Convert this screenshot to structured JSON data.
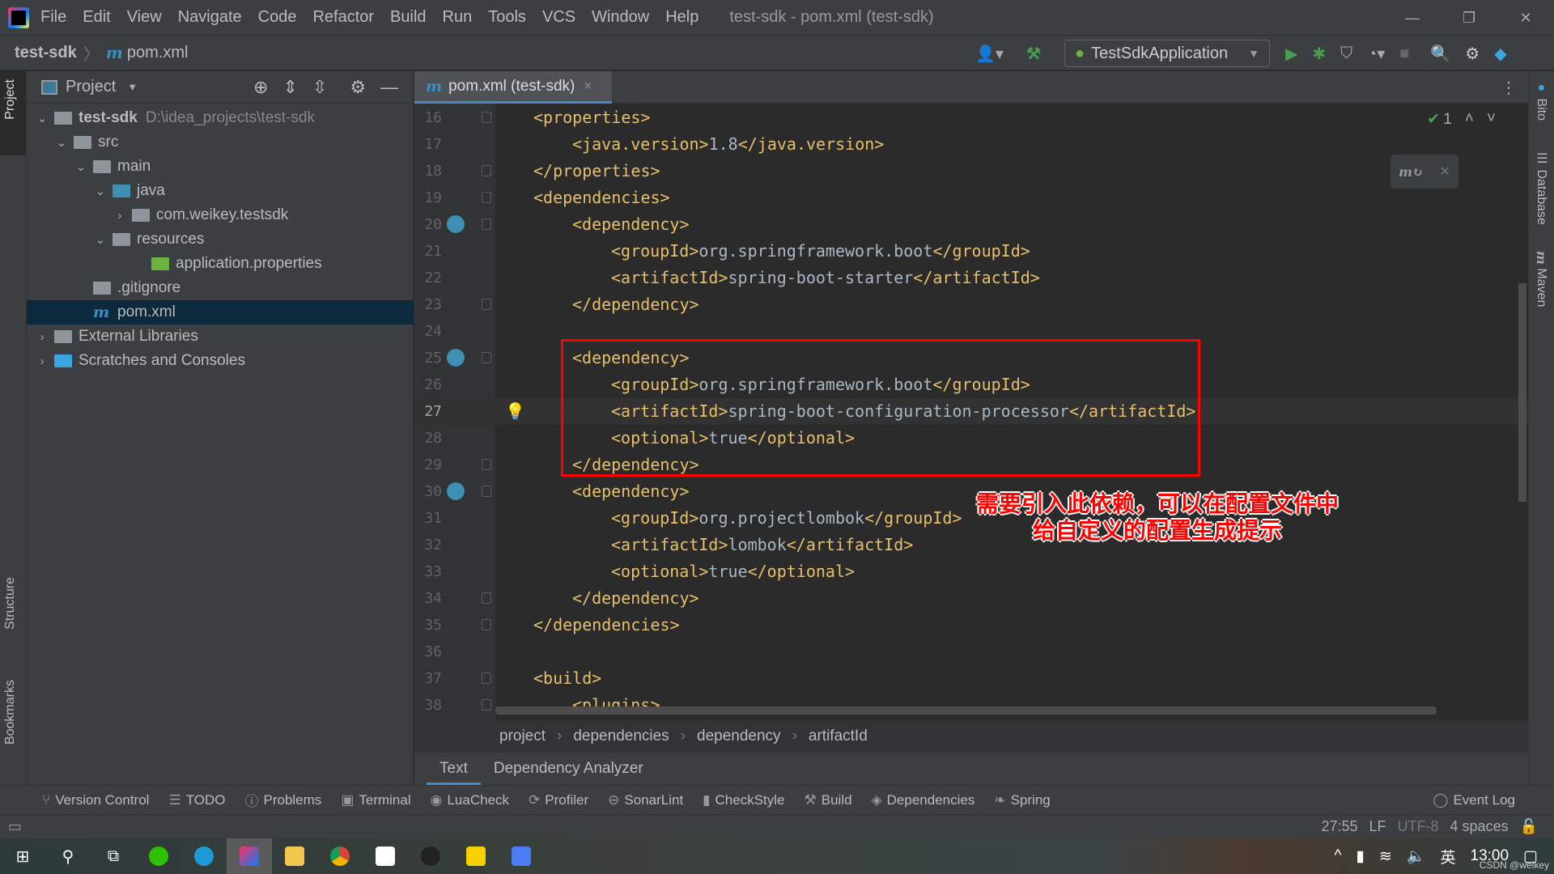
{
  "menu": [
    "File",
    "Edit",
    "View",
    "Navigate",
    "Code",
    "Refactor",
    "Build",
    "Run",
    "Tools",
    "VCS",
    "Window",
    "Help"
  ],
  "window_title": "test-sdk - pom.xml (test-sdk)",
  "nav": {
    "project": "test-sdk",
    "file": "pom.xml",
    "file_icon": "m"
  },
  "run_config": "TestSdkApplication",
  "project_panel": {
    "title": "Project",
    "tree": [
      {
        "label": "test-sdk",
        "path": "D:\\idea_projects\\test-sdk",
        "level": 0,
        "chev": "v",
        "icon": "module-folder",
        "bold": true
      },
      {
        "label": "src",
        "level": 1,
        "chev": "v",
        "icon": "folder"
      },
      {
        "label": "main",
        "level": 2,
        "chev": "v",
        "icon": "folder"
      },
      {
        "label": "java",
        "level": 3,
        "chev": "v",
        "icon": "source-folder"
      },
      {
        "label": "com.weikey.testsdk",
        "level": 4,
        "chev": ">",
        "icon": "package"
      },
      {
        "label": "resources",
        "level": 3,
        "chev": "v",
        "icon": "resources-folder"
      },
      {
        "label": "application.properties",
        "level": 5,
        "chev": "",
        "icon": "spring-properties"
      },
      {
        "label": ".gitignore",
        "level": 2,
        "chev": "",
        "icon": "ignore-file"
      },
      {
        "label": "pom.xml",
        "level": 2,
        "chev": "",
        "icon": "maven",
        "selected": true
      },
      {
        "label": "External Libraries",
        "level": 0,
        "chev": ">",
        "icon": "libraries"
      },
      {
        "label": "Scratches and Consoles",
        "level": 0,
        "chev": ">",
        "icon": "scratches"
      }
    ]
  },
  "editor": {
    "tab": "pom.xml (test-sdk)",
    "inspection_count": "1",
    "lines": [
      {
        "n": "16",
        "indent": 1,
        "open": "<properties>",
        "fold": true
      },
      {
        "n": "17",
        "indent": 2,
        "open": "<java.version>",
        "value": "1.8",
        "close": "</java.version>"
      },
      {
        "n": "18",
        "indent": 1,
        "open": "</properties>",
        "fold": true
      },
      {
        "n": "19",
        "indent": 1,
        "open": "<dependencies>",
        "fold": true
      },
      {
        "n": "20",
        "indent": 2,
        "open": "<dependency>",
        "fold": true,
        "gicon": true
      },
      {
        "n": "21",
        "indent": 3,
        "open": "<groupId>",
        "value": "org.springframework.boot",
        "close": "</groupId>"
      },
      {
        "n": "22",
        "indent": 3,
        "open": "<artifactId>",
        "value": "spring-boot-starter",
        "close": "</artifactId>"
      },
      {
        "n": "23",
        "indent": 2,
        "open": "</dependency>",
        "fold": true
      },
      {
        "n": "24",
        "indent": 0,
        "open": ""
      },
      {
        "n": "25",
        "indent": 2,
        "open": "<dependency>",
        "fold": true,
        "gicon": true
      },
      {
        "n": "26",
        "indent": 3,
        "open": "<groupId>",
        "value": "org.springframework.boot",
        "close": "</groupId>"
      },
      {
        "n": "27",
        "indent": 3,
        "open": "<artifactId>",
        "value": "spring-boot-configuration-processor",
        "close": "</artifactId>",
        "current": true,
        "bulb": true
      },
      {
        "n": "28",
        "indent": 3,
        "open": "<optional>",
        "value": "true",
        "close": "</optional>"
      },
      {
        "n": "29",
        "indent": 2,
        "open": "</dependency>",
        "fold": true
      },
      {
        "n": "30",
        "indent": 2,
        "open": "<dependency>",
        "fold": true,
        "gicon": true
      },
      {
        "n": "31",
        "indent": 3,
        "open": "<groupId>",
        "value": "org.projectlombok",
        "close": "</groupId>"
      },
      {
        "n": "32",
        "indent": 3,
        "open": "<artifactId>",
        "value": "lombok",
        "close": "</artifactId>"
      },
      {
        "n": "33",
        "indent": 3,
        "open": "<optional>",
        "value": "true",
        "close": "</optional>"
      },
      {
        "n": "34",
        "indent": 2,
        "open": "</dependency>",
        "fold": true
      },
      {
        "n": "35",
        "indent": 1,
        "open": "</dependencies>",
        "fold": true
      },
      {
        "n": "36",
        "indent": 0,
        "open": ""
      },
      {
        "n": "37",
        "indent": 1,
        "open": "<build>",
        "fold": true
      },
      {
        "n": "38",
        "indent": 2,
        "open": "<plugins>",
        "fold": true
      }
    ]
  },
  "annotation": {
    "line1": "需要引入此依赖，可以在配置文件中",
    "line2": "给自定义的配置生成提示",
    "color": "#ff0000"
  },
  "breadcrumb": [
    "project",
    "dependencies",
    "dependency",
    "artifactId"
  ],
  "subtabs": [
    "Text",
    "Dependency Analyzer"
  ],
  "toolwindows": [
    "Version Control",
    "TODO",
    "Problems",
    "Terminal",
    "LuaCheck",
    "Profiler",
    "SonarLint",
    "CheckStyle",
    "Build",
    "Dependencies",
    "Spring"
  ],
  "event_log": "Event Log",
  "status": {
    "position": "27:55",
    "line_sep": "LF",
    "encoding": "UTF-8",
    "indent": "4 spaces"
  },
  "left_stripe": [
    "Project",
    "Structure",
    "Bookmarks"
  ],
  "right_stripe": [
    "Bito",
    "Database",
    "Maven"
  ],
  "taskbar": {
    "time": "13:00",
    "ime": "英",
    "watermark": "CSDN @weikey"
  }
}
